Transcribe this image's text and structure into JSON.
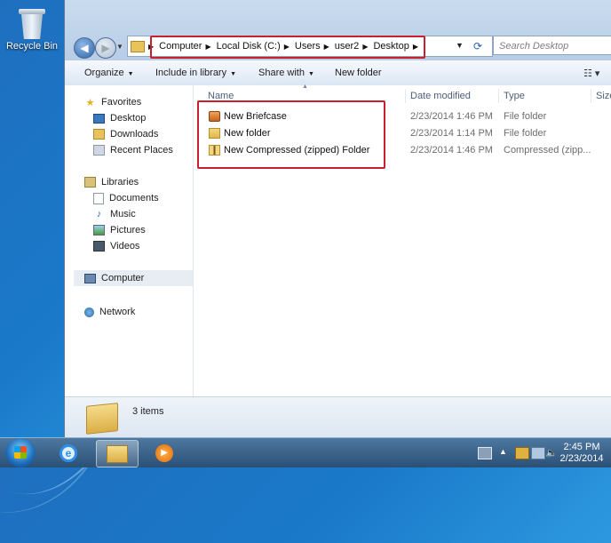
{
  "desktop": {
    "recycle_bin_label": "Recycle Bin"
  },
  "explorer": {
    "address": {
      "crumbs": [
        "Computer",
        "Local Disk (C:)",
        "Users",
        "user2",
        "Desktop"
      ],
      "search_placeholder": "Search Desktop"
    },
    "toolbar": {
      "organize": "Organize",
      "include_in_library": "Include in library",
      "share_with": "Share with",
      "new_folder": "New folder"
    },
    "navigation": {
      "favorites": "Favorites",
      "desktop": "Desktop",
      "downloads": "Downloads",
      "recent_places": "Recent Places",
      "libraries": "Libraries",
      "documents": "Documents",
      "music": "Music",
      "pictures": "Pictures",
      "videos": "Videos",
      "computer": "Computer",
      "network": "Network"
    },
    "columns": {
      "name": "Name",
      "date_modified": "Date modified",
      "type": "Type",
      "size": "Size"
    },
    "files": [
      {
        "name": "New Briefcase",
        "date": "2/23/2014 1:46 PM",
        "type": "File folder",
        "icon": "briefcase-icon"
      },
      {
        "name": "New folder",
        "date": "2/23/2014 1:14 PM",
        "type": "File folder",
        "icon": "folder-icon"
      },
      {
        "name": "New Compressed (zipped) Folder",
        "date": "2/23/2014 1:46 PM",
        "type": "Compressed (zipp...",
        "icon": "zip-folder-icon"
      }
    ],
    "details": {
      "item_count": "3 items"
    }
  },
  "taskbar": {
    "clock_time": "2:45 PM",
    "clock_date": "2/23/2014"
  },
  "colors": {
    "highlight_box": "#c8202c",
    "taskbar": "#2b5076"
  }
}
